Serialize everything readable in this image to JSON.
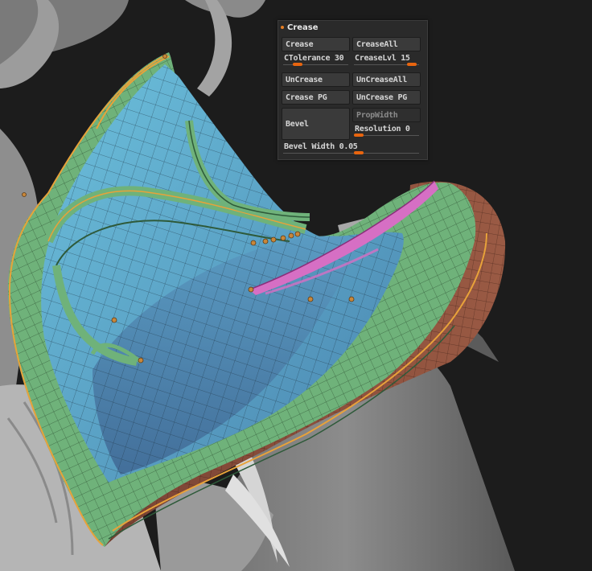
{
  "palette": {
    "background": "#1c1c1c",
    "sculpt_gray": "#8f8f8f",
    "polygroup_blue": "#5aa9c9",
    "polygroup_blue_dark": "#4f8fb6",
    "polygroup_green": "#6fb27a",
    "polygroup_brown": "#8a4f3a",
    "polygroup_pink": "#d66fc4",
    "crease_orange": "#e8a23a",
    "slider_knob": "#e8650f"
  },
  "crease_panel": {
    "title": "Crease",
    "crease": "Crease",
    "crease_all": "CreaseAll",
    "ctolerance": {
      "label": "CTolerance 30",
      "value": 30,
      "fraction": 0.25
    },
    "crease_lvl": {
      "label": "CreaseLvl 15",
      "value": 15,
      "fraction": 0.95
    },
    "uncrease": "UnCrease",
    "uncrease_all": "UnCreaseAll",
    "crease_pg": "Crease PG",
    "uncrease_pg": "UnCrease PG",
    "bevel": "Bevel",
    "prop_width": "PropWidth",
    "resolution": {
      "label": "Resolution 0",
      "value": 0,
      "fraction": 0.0
    },
    "bevel_width": {
      "label": "Bevel Width 0.05",
      "value": 0.05,
      "fraction": 0.52
    }
  }
}
